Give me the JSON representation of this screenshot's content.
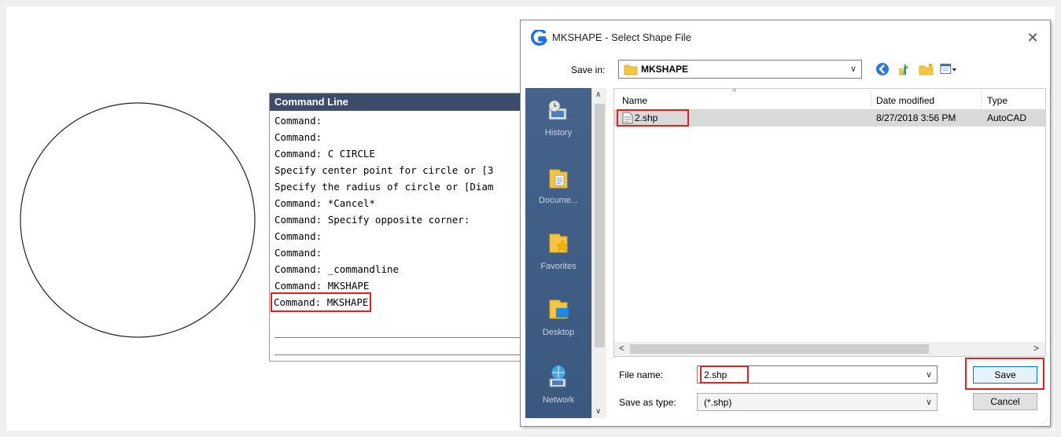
{
  "command_line": {
    "title": "Command Line",
    "lines": [
      "Command:",
      "Command:",
      "Command: C CIRCLE",
      "Specify center point for circle or [3",
      "Specify the radius of circle or [Diam",
      "Command: *Cancel*",
      "Command: Specify opposite corner:",
      "Command:",
      "Command:",
      "Command: _commandline",
      "Command: MKSHAPE",
      "Command: MKSHAPE"
    ]
  },
  "dialog": {
    "title": "MKSHAPE - Select Shape File",
    "save_in_label": "Save in:",
    "save_in_value": "MKSHAPE",
    "places": [
      "History",
      "Docume...",
      "Favorites",
      "Desktop",
      "Network"
    ],
    "columns": [
      "Name",
      "Date modified",
      "Type"
    ],
    "files": [
      {
        "name": "2.shp",
        "date": "8/27/2018 3:56 PM",
        "type": "AutoCAD"
      }
    ],
    "file_name_label": "File name:",
    "file_name_value": "2.shp",
    "save_as_type_label": "Save as type:",
    "save_as_type_value": "(*.shp)",
    "save_button": "Save",
    "cancel_button": "Cancel"
  },
  "colors": {
    "highlight": "#e0201a",
    "command_title_bg": "#3b4d6b",
    "places_bg": "#3e5a7e"
  }
}
